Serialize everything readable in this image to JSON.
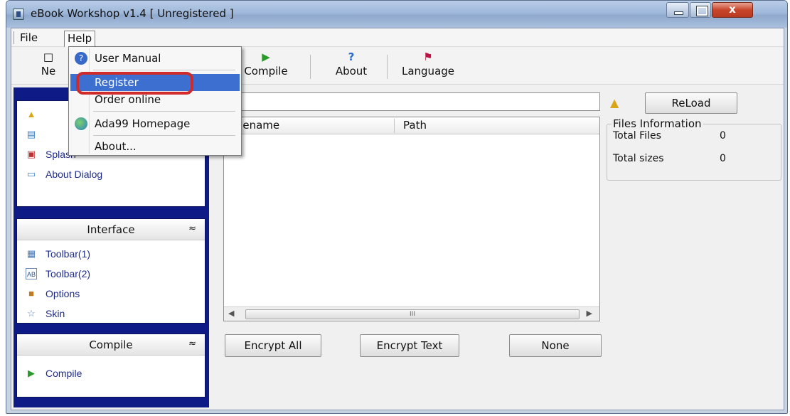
{
  "window": {
    "title": "eBook Workshop v1.4 [ Unregistered ]",
    "controls": {
      "close_glyph": "x"
    }
  },
  "menubar": {
    "file": "File",
    "help": "Help"
  },
  "toolbar": {
    "new": "Ne",
    "compile": "Compile",
    "about": "About",
    "language": "Language",
    "compile_icon": "play-icon",
    "about_icon": "help-arrow-icon",
    "language_icon": "language-icon"
  },
  "help_menu": {
    "items": [
      {
        "label": "User Manual",
        "icon": "help-circle-icon"
      },
      {
        "label": "Register",
        "selected": true
      },
      {
        "label": "Order online"
      },
      {
        "label": "Ada99 Homepage",
        "icon": "globe-icon"
      },
      {
        "label": "About..."
      }
    ]
  },
  "sidebar": {
    "project_items": [
      "Splash",
      "About Dialog"
    ],
    "interface": {
      "title": "Interface",
      "items": [
        "Toolbar(1)",
        "Toolbar(2)",
        "Options",
        "Skin"
      ]
    },
    "compile": {
      "title": "Compile",
      "items": [
        "Compile"
      ]
    },
    "chevron": "≈"
  },
  "main": {
    "path_value": "",
    "reload": "ReLoad",
    "columns": [
      "ilename",
      "Path"
    ],
    "scroll_label": "III",
    "files_info": {
      "title": "Files Information",
      "total_files_label": "Total Files",
      "total_files": "0",
      "total_sizes_label": "Total sizes",
      "total_sizes": "0"
    },
    "buttons": {
      "encrypt_all": "Encrypt All",
      "encrypt_text": "Encrypt Text",
      "none": "None"
    }
  },
  "colors": {
    "sidebar_bg": "#0e1a86",
    "selection": "#3c6fd0",
    "annotation": "#d12a2a"
  }
}
